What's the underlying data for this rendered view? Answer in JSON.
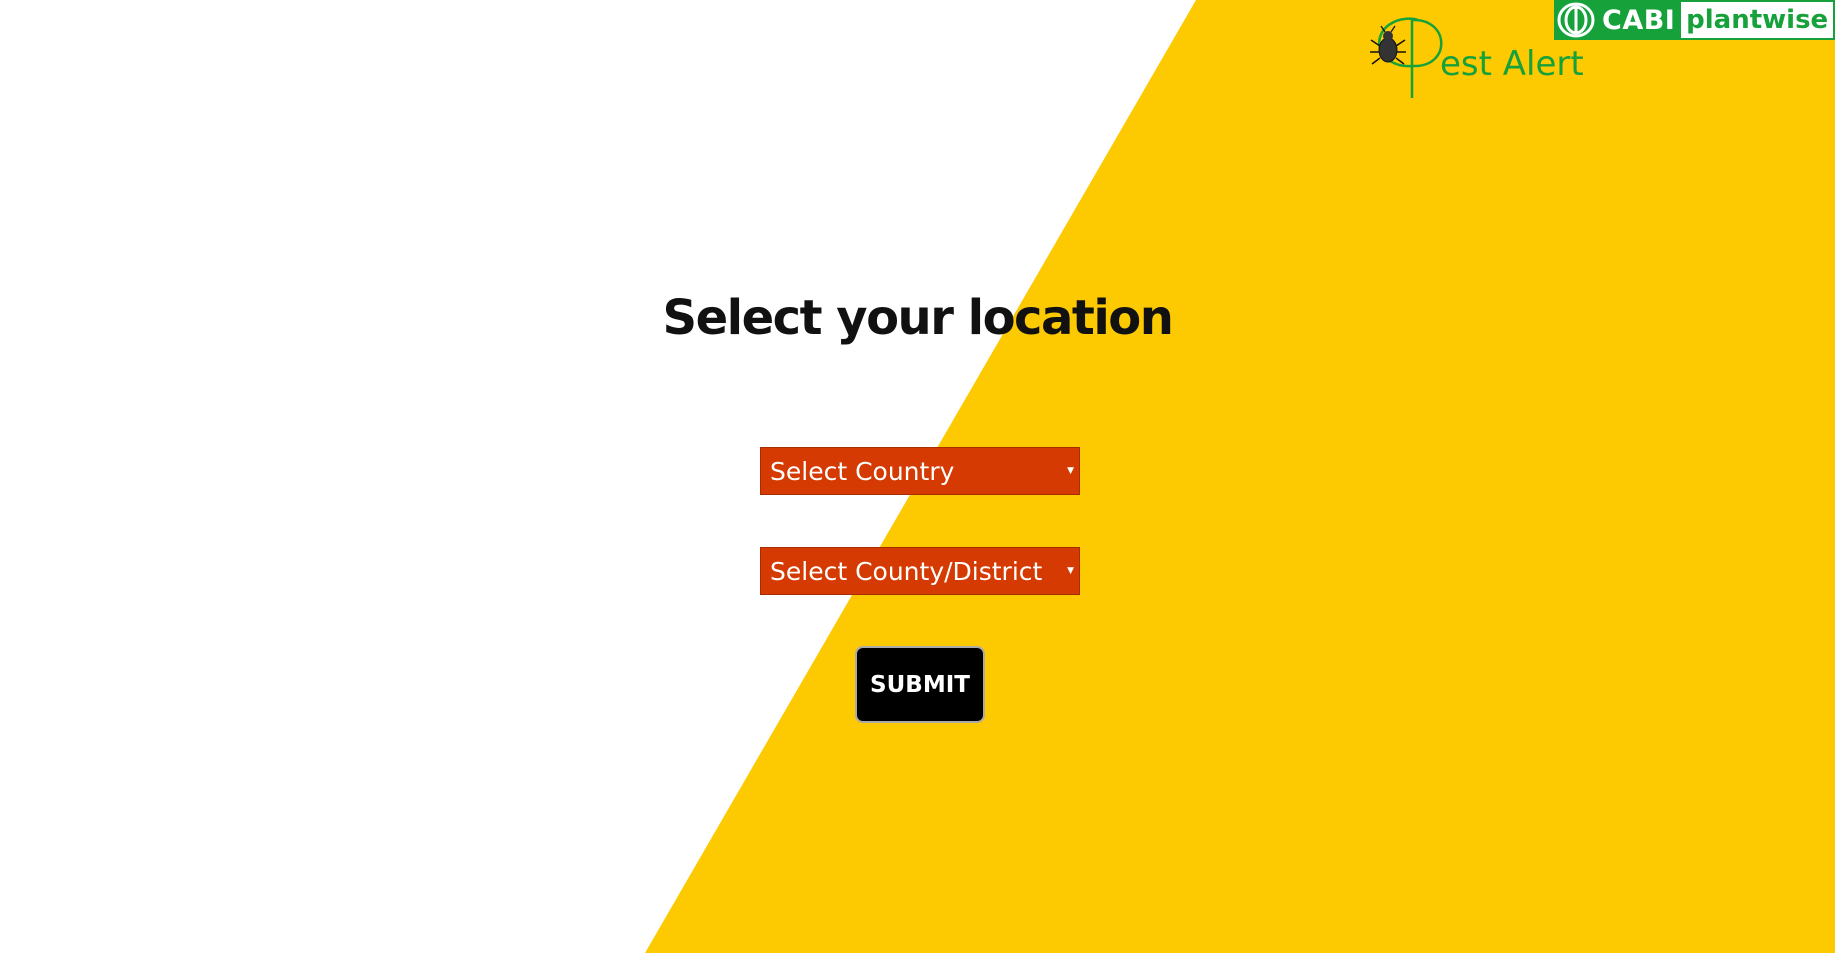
{
  "colors": {
    "accent_yellow": "#fdc900",
    "select_bg": "#d43a02",
    "brand_green": "#17a13b",
    "button_bg": "#000000"
  },
  "brand": {
    "cabi_label": "CABI",
    "plantwise_label": "plantwise",
    "cabi_icon": "cabi-leaf-icon",
    "pest_alert_label": "est Alert",
    "pest_alert_icon": "bug-icon"
  },
  "main": {
    "title": "Select your location",
    "country_select": {
      "selected": "Select Country",
      "caret_icon": "caret-down-icon"
    },
    "district_select": {
      "selected": "Select County/District",
      "caret_icon": "caret-down-icon"
    },
    "submit_label": "SUBMIT"
  }
}
